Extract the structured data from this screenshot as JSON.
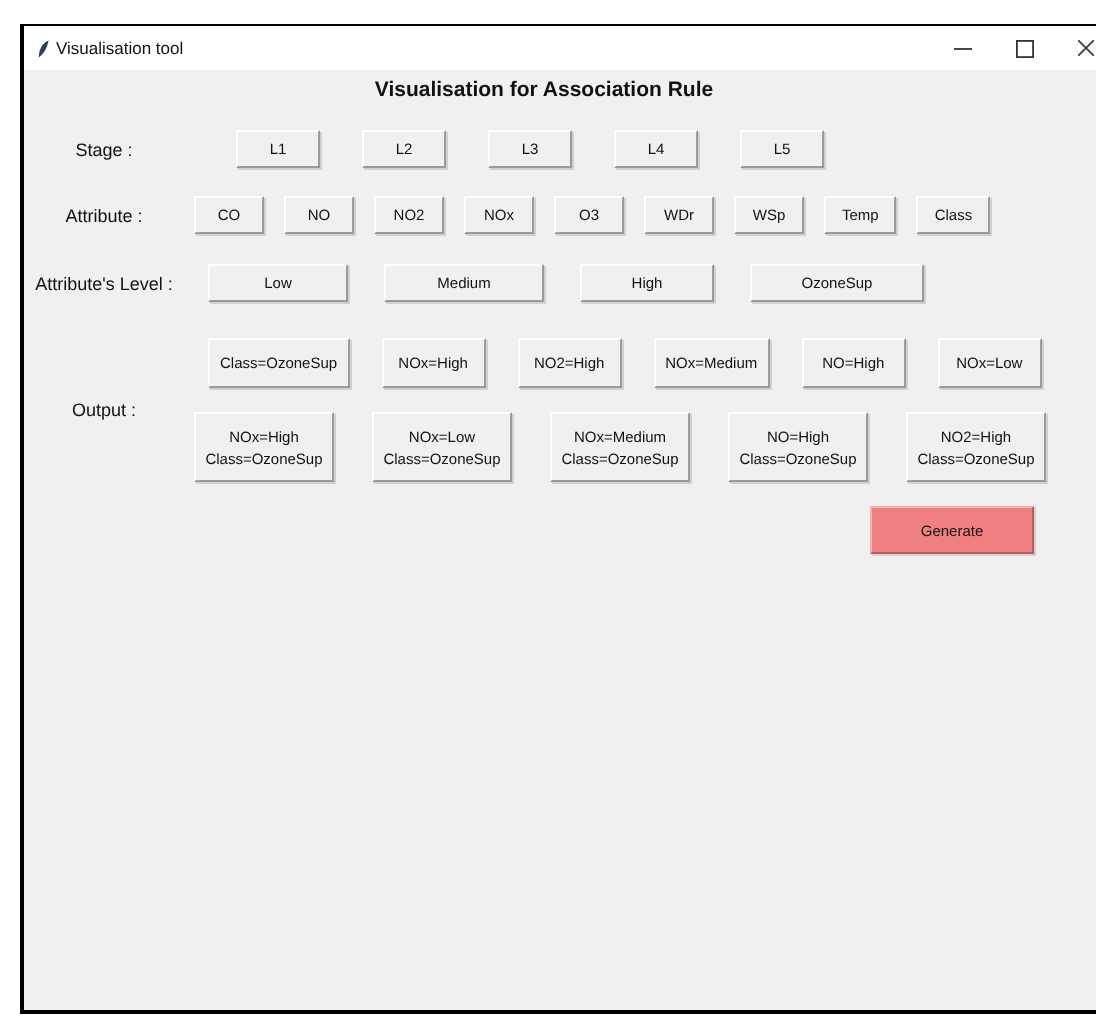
{
  "window": {
    "title": "Visualisation tool"
  },
  "heading": "Visualisation for Association Rule",
  "rows": [
    {
      "kind": "stage",
      "label": "Stage :",
      "buttons": [
        "L1",
        "L2",
        "L3",
        "L4",
        "L5"
      ]
    },
    {
      "kind": "attribute",
      "label": "Attribute :",
      "buttons": [
        "CO",
        "NO",
        "NO2",
        "NOx",
        "O3",
        "WDr",
        "WSp",
        "Temp",
        "Class"
      ]
    },
    {
      "kind": "level",
      "label": "Attribute's Level :",
      "buttons": [
        "Low",
        "Medium",
        "High",
        "OzoneSup"
      ]
    }
  ],
  "output": {
    "label": "Output :",
    "single_rules": [
      "Class=OzoneSup",
      "NOx=High",
      "NO2=High",
      "NOx=Medium",
      "NO=High",
      "NOx=Low"
    ],
    "pair_rules": [
      "NOx=High\nClass=OzoneSup",
      "NOx=Low\nClass=OzoneSup",
      "NOx=Medium\nClass=OzoneSup",
      "NO=High\nClass=OzoneSup",
      "NO2=High\nClass=OzoneSup"
    ]
  },
  "generate_button": "Generate"
}
